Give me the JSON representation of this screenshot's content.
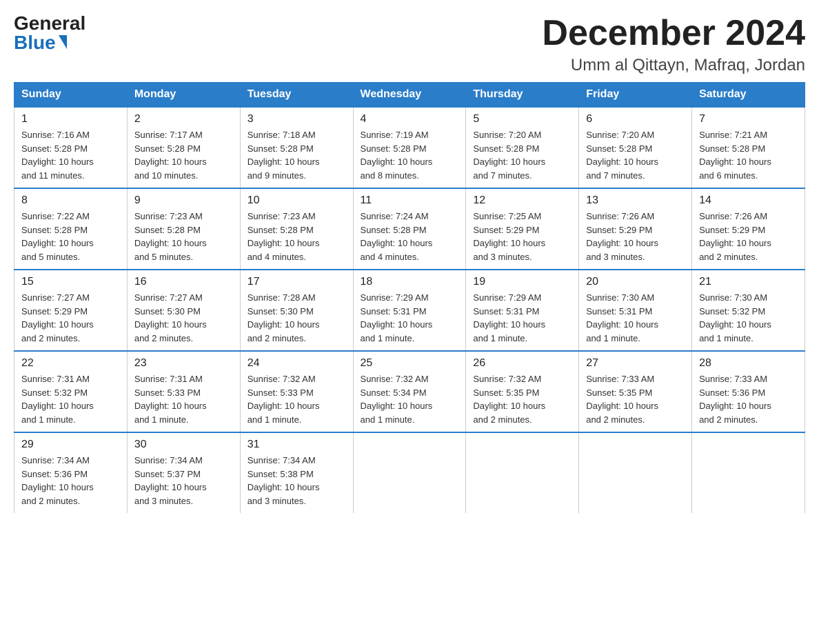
{
  "logo": {
    "general": "General",
    "blue": "Blue"
  },
  "title": {
    "month": "December 2024",
    "location": "Umm al Qittayn, Mafraq, Jordan"
  },
  "days_of_week": [
    "Sunday",
    "Monday",
    "Tuesday",
    "Wednesday",
    "Thursday",
    "Friday",
    "Saturday"
  ],
  "weeks": [
    [
      {
        "day": "1",
        "sunrise": "7:16 AM",
        "sunset": "5:28 PM",
        "daylight": "10 hours and 11 minutes."
      },
      {
        "day": "2",
        "sunrise": "7:17 AM",
        "sunset": "5:28 PM",
        "daylight": "10 hours and 10 minutes."
      },
      {
        "day": "3",
        "sunrise": "7:18 AM",
        "sunset": "5:28 PM",
        "daylight": "10 hours and 9 minutes."
      },
      {
        "day": "4",
        "sunrise": "7:19 AM",
        "sunset": "5:28 PM",
        "daylight": "10 hours and 8 minutes."
      },
      {
        "day": "5",
        "sunrise": "7:20 AM",
        "sunset": "5:28 PM",
        "daylight": "10 hours and 7 minutes."
      },
      {
        "day": "6",
        "sunrise": "7:20 AM",
        "sunset": "5:28 PM",
        "daylight": "10 hours and 7 minutes."
      },
      {
        "day": "7",
        "sunrise": "7:21 AM",
        "sunset": "5:28 PM",
        "daylight": "10 hours and 6 minutes."
      }
    ],
    [
      {
        "day": "8",
        "sunrise": "7:22 AM",
        "sunset": "5:28 PM",
        "daylight": "10 hours and 5 minutes."
      },
      {
        "day": "9",
        "sunrise": "7:23 AM",
        "sunset": "5:28 PM",
        "daylight": "10 hours and 5 minutes."
      },
      {
        "day": "10",
        "sunrise": "7:23 AM",
        "sunset": "5:28 PM",
        "daylight": "10 hours and 4 minutes."
      },
      {
        "day": "11",
        "sunrise": "7:24 AM",
        "sunset": "5:28 PM",
        "daylight": "10 hours and 4 minutes."
      },
      {
        "day": "12",
        "sunrise": "7:25 AM",
        "sunset": "5:29 PM",
        "daylight": "10 hours and 3 minutes."
      },
      {
        "day": "13",
        "sunrise": "7:26 AM",
        "sunset": "5:29 PM",
        "daylight": "10 hours and 3 minutes."
      },
      {
        "day": "14",
        "sunrise": "7:26 AM",
        "sunset": "5:29 PM",
        "daylight": "10 hours and 2 minutes."
      }
    ],
    [
      {
        "day": "15",
        "sunrise": "7:27 AM",
        "sunset": "5:29 PM",
        "daylight": "10 hours and 2 minutes."
      },
      {
        "day": "16",
        "sunrise": "7:27 AM",
        "sunset": "5:30 PM",
        "daylight": "10 hours and 2 minutes."
      },
      {
        "day": "17",
        "sunrise": "7:28 AM",
        "sunset": "5:30 PM",
        "daylight": "10 hours and 2 minutes."
      },
      {
        "day": "18",
        "sunrise": "7:29 AM",
        "sunset": "5:31 PM",
        "daylight": "10 hours and 1 minute."
      },
      {
        "day": "19",
        "sunrise": "7:29 AM",
        "sunset": "5:31 PM",
        "daylight": "10 hours and 1 minute."
      },
      {
        "day": "20",
        "sunrise": "7:30 AM",
        "sunset": "5:31 PM",
        "daylight": "10 hours and 1 minute."
      },
      {
        "day": "21",
        "sunrise": "7:30 AM",
        "sunset": "5:32 PM",
        "daylight": "10 hours and 1 minute."
      }
    ],
    [
      {
        "day": "22",
        "sunrise": "7:31 AM",
        "sunset": "5:32 PM",
        "daylight": "10 hours and 1 minute."
      },
      {
        "day": "23",
        "sunrise": "7:31 AM",
        "sunset": "5:33 PM",
        "daylight": "10 hours and 1 minute."
      },
      {
        "day": "24",
        "sunrise": "7:32 AM",
        "sunset": "5:33 PM",
        "daylight": "10 hours and 1 minute."
      },
      {
        "day": "25",
        "sunrise": "7:32 AM",
        "sunset": "5:34 PM",
        "daylight": "10 hours and 1 minute."
      },
      {
        "day": "26",
        "sunrise": "7:32 AM",
        "sunset": "5:35 PM",
        "daylight": "10 hours and 2 minutes."
      },
      {
        "day": "27",
        "sunrise": "7:33 AM",
        "sunset": "5:35 PM",
        "daylight": "10 hours and 2 minutes."
      },
      {
        "day": "28",
        "sunrise": "7:33 AM",
        "sunset": "5:36 PM",
        "daylight": "10 hours and 2 minutes."
      }
    ],
    [
      {
        "day": "29",
        "sunrise": "7:34 AM",
        "sunset": "5:36 PM",
        "daylight": "10 hours and 2 minutes."
      },
      {
        "day": "30",
        "sunrise": "7:34 AM",
        "sunset": "5:37 PM",
        "daylight": "10 hours and 3 minutes."
      },
      {
        "day": "31",
        "sunrise": "7:34 AM",
        "sunset": "5:38 PM",
        "daylight": "10 hours and 3 minutes."
      },
      null,
      null,
      null,
      null
    ]
  ],
  "labels": {
    "sunrise": "Sunrise:",
    "sunset": "Sunset:",
    "daylight": "Daylight:"
  }
}
